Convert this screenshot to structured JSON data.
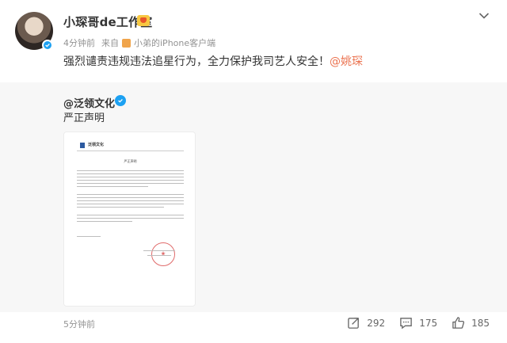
{
  "post": {
    "username": "小琛哥de工作室",
    "time": "4分钟前",
    "source_prefix": "来自",
    "source": "小弟的iPhone客户端",
    "text": "强烈谴责违规违法追星行为，全力保护我司艺人安全！",
    "mention": "@姚琛"
  },
  "repost": {
    "username": "@泛领文化",
    "text": "严正声明",
    "time": "5分钟前",
    "document": {
      "company": "泛领文化",
      "title": "严正声明"
    }
  },
  "actions": {
    "share_count": "292",
    "comment_count": "175",
    "like_count": "185"
  },
  "icons": [
    "more-chevron-icon",
    "vip-badge-icon",
    "verified-icon",
    "share-icon",
    "comment-icon",
    "like-icon"
  ],
  "colors": {
    "mention": "#eb7350",
    "verified": "#1da1f2",
    "meta": "#939393",
    "repost_bg": "#f7f7f7"
  }
}
